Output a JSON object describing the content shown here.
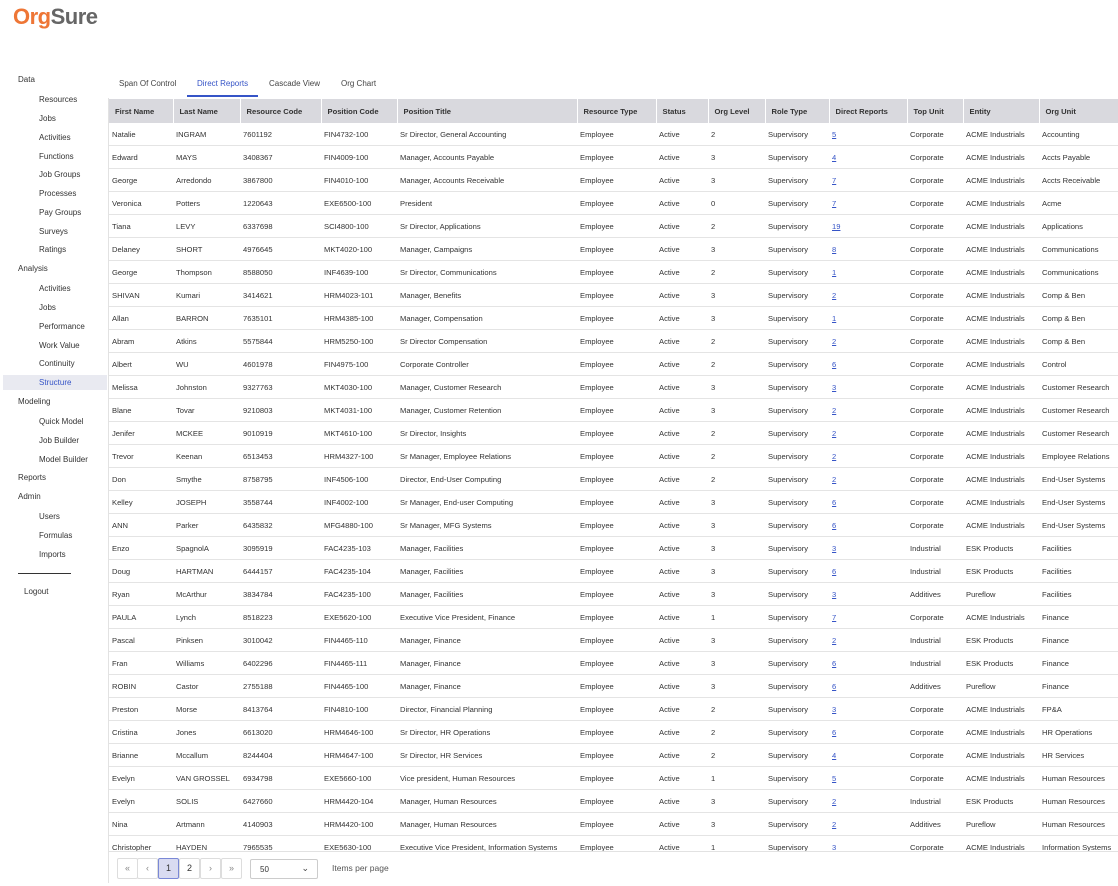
{
  "app": {
    "logo_a": "Org",
    "logo_b": "Sure"
  },
  "sidebar": {
    "data_label": "Data",
    "data_items": [
      "Resources",
      "Jobs",
      "Activities",
      "Functions",
      "Job Groups",
      "Processes",
      "Pay Groups",
      "Surveys",
      "Ratings"
    ],
    "analysis_label": "Analysis",
    "analysis_items": [
      "Activities",
      "Jobs",
      "Performance",
      "Work Value",
      "Continuity",
      "Structure"
    ],
    "active_item": "Structure",
    "modeling_label": "Modeling",
    "modeling_items": [
      "Quick Model",
      "Job Builder",
      "Model Builder"
    ],
    "reports_label": "Reports",
    "admin_label": "Admin",
    "admin_items": [
      "Users",
      "Formulas",
      "Imports"
    ],
    "logout_label": "Logout"
  },
  "tabs": [
    "Span Of Control",
    "Direct Reports",
    "Cascade View",
    "Org Chart"
  ],
  "active_tab": "Direct Reports",
  "table": {
    "columns": [
      "First Name",
      "Last Name",
      "Resource Code",
      "Position Code",
      "Position Title",
      "Resource Type",
      "Status",
      "Org Level",
      "Role Type",
      "Direct Reports",
      "Top Unit",
      "Entity",
      "Org Unit"
    ],
    "rows": [
      [
        "Natalie",
        "INGRAM",
        "7601192",
        "FIN4732-100",
        "Sr Director, General Accounting",
        "Employee",
        "Active",
        "2",
        "Supervisory",
        "5",
        "Corporate",
        "ACME Industrials",
        "Accounting"
      ],
      [
        "Edward",
        "MAYS",
        "3408367",
        "FIN4009-100",
        "Manager, Accounts Payable",
        "Employee",
        "Active",
        "3",
        "Supervisory",
        "4",
        "Corporate",
        "ACME Industrials",
        "Accts Payable"
      ],
      [
        "George",
        "Arredondo",
        "3867800",
        "FIN4010-100",
        "Manager, Accounts Receivable",
        "Employee",
        "Active",
        "3",
        "Supervisory",
        "7",
        "Corporate",
        "ACME Industrials",
        "Accts Receivable"
      ],
      [
        "Veronica",
        "Potters",
        "1220643",
        "EXE6500-100",
        "President",
        "Employee",
        "Active",
        "0",
        "Supervisory",
        "7",
        "Corporate",
        "ACME Industrials",
        "Acme"
      ],
      [
        "Tiana",
        "LEVY",
        "6337698",
        "SCI4800-100",
        "Sr Director, Applications",
        "Employee",
        "Active",
        "2",
        "Supervisory",
        "19",
        "Corporate",
        "ACME Industrials",
        "Applications"
      ],
      [
        "Delaney",
        "SHORT",
        "4976645",
        "MKT4020-100",
        "Manager, Campaigns",
        "Employee",
        "Active",
        "3",
        "Supervisory",
        "8",
        "Corporate",
        "ACME Industrials",
        "Communications"
      ],
      [
        "George",
        "Thompson",
        "8588050",
        "INF4639-100",
        "Sr Director, Communications",
        "Employee",
        "Active",
        "2",
        "Supervisory",
        "1",
        "Corporate",
        "ACME Industrials",
        "Communications"
      ],
      [
        "SHIVAN",
        "Kumari",
        "3414621",
        "HRM4023-101",
        "Manager, Benefits",
        "Employee",
        "Active",
        "3",
        "Supervisory",
        "2",
        "Corporate",
        "ACME Industrials",
        "Comp & Ben"
      ],
      [
        "Allan",
        "BARRON",
        "7635101",
        "HRM4385-100",
        "Manager, Compensation",
        "Employee",
        "Active",
        "3",
        "Supervisory",
        "1",
        "Corporate",
        "ACME Industrials",
        "Comp & Ben"
      ],
      [
        "Abram",
        "Atkins",
        "5575844",
        "HRM5250-100",
        "Sr Director Compensation",
        "Employee",
        "Active",
        "2",
        "Supervisory",
        "2",
        "Corporate",
        "ACME Industrials",
        "Comp & Ben"
      ],
      [
        "Albert",
        "WU",
        "4601978",
        "FIN4975-100",
        "Corporate Controller",
        "Employee",
        "Active",
        "2",
        "Supervisory",
        "6",
        "Corporate",
        "ACME Industrials",
        "Control"
      ],
      [
        "Melissa",
        "Johnston",
        "9327763",
        "MKT4030-100",
        "Manager, Customer Research",
        "Employee",
        "Active",
        "3",
        "Supervisory",
        "3",
        "Corporate",
        "ACME Industrials",
        "Customer Research"
      ],
      [
        "Blane",
        "Tovar",
        "9210803",
        "MKT4031-100",
        "Manager, Customer Retention",
        "Employee",
        "Active",
        "3",
        "Supervisory",
        "2",
        "Corporate",
        "ACME Industrials",
        "Customer Research"
      ],
      [
        "Jenifer",
        "MCKEE",
        "9010919",
        "MKT4610-100",
        "Sr Director, Insights",
        "Employee",
        "Active",
        "2",
        "Supervisory",
        "2",
        "Corporate",
        "ACME Industrials",
        "Customer Research"
      ],
      [
        "Trevor",
        "Keenan",
        "6513453",
        "HRM4327-100",
        "Sr Manager, Employee Relations",
        "Employee",
        "Active",
        "2",
        "Supervisory",
        "2",
        "Corporate",
        "ACME Industrials",
        "Employee Relations"
      ],
      [
        "Don",
        "Smythe",
        "8758795",
        "INF4506-100",
        "Director, End-User Computing",
        "Employee",
        "Active",
        "2",
        "Supervisory",
        "2",
        "Corporate",
        "ACME Industrials",
        "End-User Systems"
      ],
      [
        "Kelley",
        "JOSEPH",
        "3558744",
        "INF4002-100",
        "Sr Manager, End-user Computing",
        "Employee",
        "Active",
        "3",
        "Supervisory",
        "6",
        "Corporate",
        "ACME Industrials",
        "End-User Systems"
      ],
      [
        "ANN",
        "Parker",
        "6435832",
        "MFG4880-100",
        "Sr Manager, MFG Systems",
        "Employee",
        "Active",
        "3",
        "Supervisory",
        "6",
        "Corporate",
        "ACME Industrials",
        "End-User Systems"
      ],
      [
        "Enzo",
        "SpagnolA",
        "3095919",
        "FAC4235-103",
        "Manager, Facilities",
        "Employee",
        "Active",
        "3",
        "Supervisory",
        "3",
        "Industrial",
        "ESK Products",
        "Facilities"
      ],
      [
        "Doug",
        "HARTMAN",
        "6444157",
        "FAC4235-104",
        "Manager, Facilities",
        "Employee",
        "Active",
        "3",
        "Supervisory",
        "6",
        "Industrial",
        "ESK Products",
        "Facilities"
      ],
      [
        "Ryan",
        "McArthur",
        "3834784",
        "FAC4235-100",
        "Manager, Facilities",
        "Employee",
        "Active",
        "3",
        "Supervisory",
        "3",
        "Additives",
        "Pureflow",
        "Facilities"
      ],
      [
        "PAULA",
        "Lynch",
        "8518223",
        "EXE5620-100",
        "Executive Vice President, Finance",
        "Employee",
        "Active",
        "1",
        "Supervisory",
        "7",
        "Corporate",
        "ACME Industrials",
        "Finance"
      ],
      [
        "Pascal",
        "Pinksen",
        "3010042",
        "FIN4465-110",
        "Manager, Finance",
        "Employee",
        "Active",
        "3",
        "Supervisory",
        "2",
        "Industrial",
        "ESK Products",
        "Finance"
      ],
      [
        "Fran",
        "Williams",
        "6402296",
        "FIN4465-111",
        "Manager, Finance",
        "Employee",
        "Active",
        "3",
        "Supervisory",
        "6",
        "Industrial",
        "ESK Products",
        "Finance"
      ],
      [
        "ROBIN",
        "Castor",
        "2755188",
        "FIN4465-100",
        "Manager, Finance",
        "Employee",
        "Active",
        "3",
        "Supervisory",
        "6",
        "Additives",
        "Pureflow",
        "Finance"
      ],
      [
        "Preston",
        "Morse",
        "8413764",
        "FIN4810-100",
        "Director, Financial Planning",
        "Employee",
        "Active",
        "2",
        "Supervisory",
        "3",
        "Corporate",
        "ACME Industrials",
        "FP&A"
      ],
      [
        "Cristina",
        "Jones",
        "6613020",
        "HRM4646-100",
        "Sr Director, HR Operations",
        "Employee",
        "Active",
        "2",
        "Supervisory",
        "6",
        "Corporate",
        "ACME Industrials",
        "HR Operations"
      ],
      [
        "Brianne",
        "Mccallum",
        "8244404",
        "HRM4647-100",
        "Sr Director, HR Services",
        "Employee",
        "Active",
        "2",
        "Supervisory",
        "4",
        "Corporate",
        "ACME Industrials",
        "HR Services"
      ],
      [
        "Evelyn",
        "VAN GROSSEL",
        "6934798",
        "EXE5660-100",
        "Vice president, Human Resources",
        "Employee",
        "Active",
        "1",
        "Supervisory",
        "5",
        "Corporate",
        "ACME Industrials",
        "Human Resources"
      ],
      [
        "Evelyn",
        "SOLIS",
        "6427660",
        "HRM4420-104",
        "Manager, Human Resources",
        "Employee",
        "Active",
        "3",
        "Supervisory",
        "2",
        "Industrial",
        "ESK Products",
        "Human Resources"
      ],
      [
        "Nina",
        "Artmann",
        "4140903",
        "HRM4420-100",
        "Manager, Human Resources",
        "Employee",
        "Active",
        "3",
        "Supervisory",
        "2",
        "Additives",
        "Pureflow",
        "Human Resources"
      ],
      [
        "Christopher",
        "HAYDEN",
        "7965535",
        "EXE5630-100",
        "Executive Vice President, Information Systems",
        "Employee",
        "Active",
        "1",
        "Supervisory",
        "3",
        "Corporate",
        "ACME Industrials",
        "Information Systems"
      ]
    ]
  },
  "pagination": {
    "first_icon": "«",
    "prev_icon": "‹",
    "pages": [
      "1",
      "2"
    ],
    "current_page": "1",
    "next_icon": "›",
    "last_icon": "»",
    "items_per_page_value": "50",
    "items_per_page_label": "Items per page"
  },
  "colors": {
    "accent": "#3654c7",
    "brand_orange": "#ee7636",
    "header_bg": "#d9d9de"
  }
}
